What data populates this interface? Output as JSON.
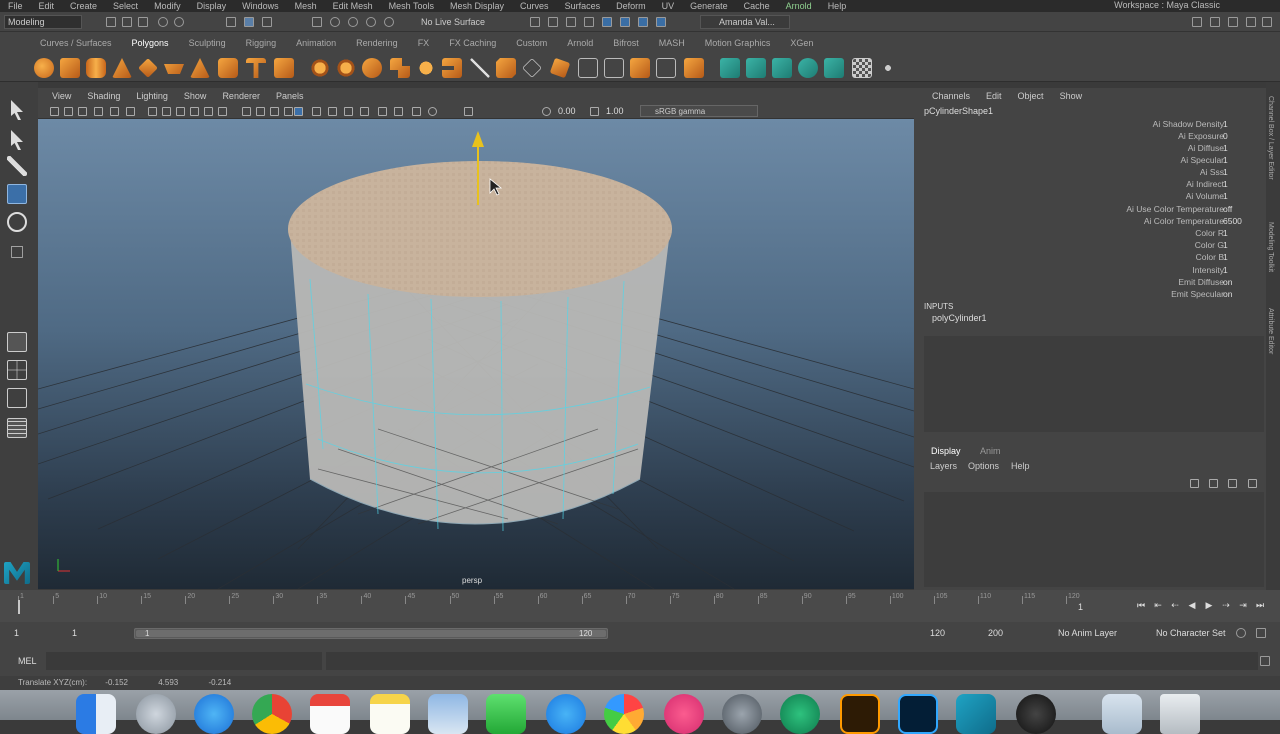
{
  "menubar": {
    "items": [
      "File",
      "Edit",
      "Create",
      "Select",
      "Modify",
      "Display",
      "Windows",
      "Mesh",
      "Edit Mesh",
      "Mesh Tools",
      "Mesh Display",
      "Curves",
      "Surfaces",
      "Deform",
      "UV",
      "Generate",
      "Cache",
      "Arnold",
      "Help"
    ],
    "workspace_label": "Workspace :",
    "workspace_value": "Maya Classic"
  },
  "statusline": {
    "mode": "Modeling",
    "live_surface": "No Live Surface",
    "user": "Amanda Val..."
  },
  "shelf": {
    "tabs": [
      "Curves / Surfaces",
      "Polygons",
      "Sculpting",
      "Rigging",
      "Animation",
      "Rendering",
      "FX",
      "FX Caching",
      "Custom",
      "Arnold",
      "Bifrost",
      "MASH",
      "Motion Graphics",
      "XGen"
    ],
    "active_tab": "Polygons"
  },
  "viewport": {
    "menu": [
      "View",
      "Shading",
      "Lighting",
      "Show",
      "Renderer",
      "Panels"
    ],
    "exposure": "0.00",
    "gamma": "1.00",
    "colorspace": "sRGB gamma",
    "camera_label": "persp"
  },
  "channelbox": {
    "menu": [
      "Channels",
      "Edit",
      "Object",
      "Show"
    ],
    "object": "pCylinderShape1",
    "attributes": [
      {
        "name": "Ai Shadow Density",
        "value": "1"
      },
      {
        "name": "Ai Exposure",
        "value": "0"
      },
      {
        "name": "Ai Diffuse",
        "value": "1"
      },
      {
        "name": "Ai Specular",
        "value": "1"
      },
      {
        "name": "Ai Sss",
        "value": "1"
      },
      {
        "name": "Ai Indirect",
        "value": "1"
      },
      {
        "name": "Ai Volume",
        "value": "1"
      },
      {
        "name": "Ai Use Color Temperature",
        "value": "off"
      },
      {
        "name": "Ai Color Temperature",
        "value": "6500"
      },
      {
        "name": "Color R",
        "value": "1"
      },
      {
        "name": "Color G",
        "value": "1"
      },
      {
        "name": "Color B",
        "value": "1"
      },
      {
        "name": "Intensity",
        "value": "1"
      },
      {
        "name": "Emit Diffuse",
        "value": "on"
      },
      {
        "name": "Emit Specular",
        "value": "on"
      }
    ],
    "inputs_header": "INPUTS",
    "inputs_item": "polyCylinder1"
  },
  "layers": {
    "tabs": [
      "Display",
      "Anim"
    ],
    "menu": [
      "Layers",
      "Options",
      "Help"
    ]
  },
  "timeline": {
    "ticks": [
      "1",
      "5",
      "10",
      "15",
      "20",
      "25",
      "30",
      "35",
      "40",
      "45",
      "50",
      "55",
      "60",
      "65",
      "70",
      "75",
      "80",
      "85",
      "90",
      "95",
      "100",
      "105",
      "110",
      "115",
      "120"
    ],
    "current_frame": "1"
  },
  "range": {
    "start": "1",
    "anim_start": "1",
    "slider_start": "1",
    "slider_end": "120",
    "anim_end": "120",
    "end": "200",
    "anim_layer": "No Anim Layer",
    "char_set": "No Character Set"
  },
  "cmdline": {
    "mel_label": "MEL"
  },
  "helpline": {
    "label": "Translate XYZ(cm):",
    "x": "-0.152",
    "y": "4.593",
    "z": "-0.214"
  },
  "sidebar_labels": [
    "Channel Box / Layer Editor",
    "Modeling Toolkit",
    "Attribute Editor"
  ]
}
